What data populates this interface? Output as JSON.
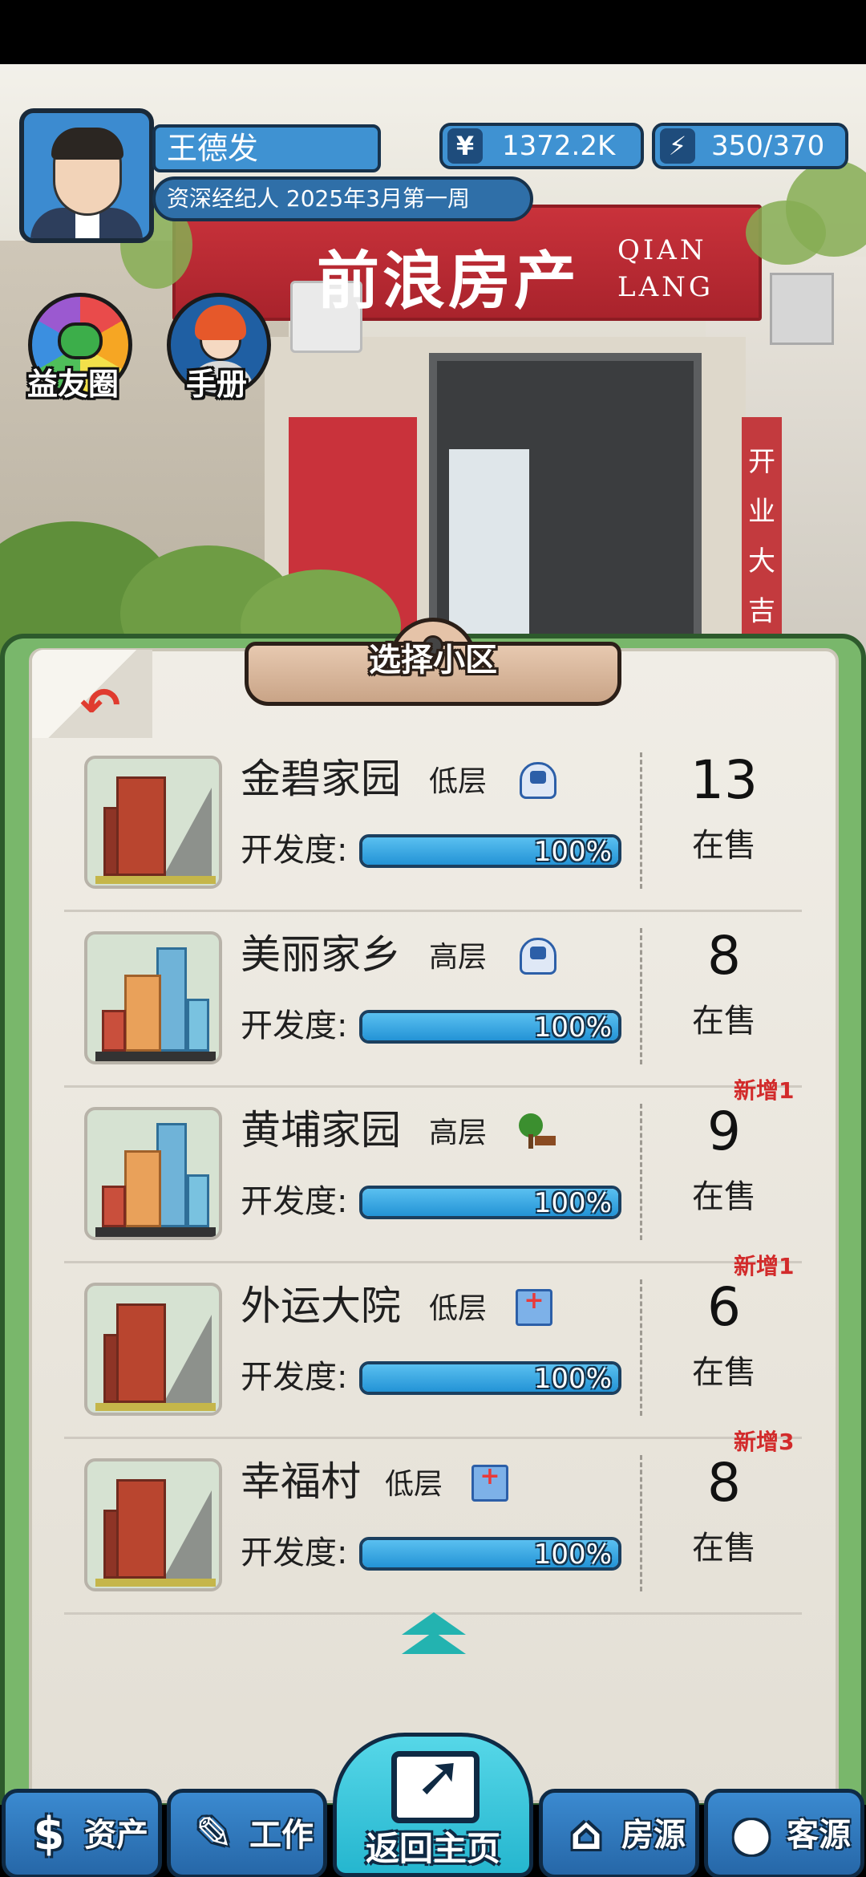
{
  "player": {
    "name": "王德发",
    "title": "资深经纪人 2025年3月第一周",
    "money": "1372.2K",
    "money_icon": "¥",
    "energy": "350/370",
    "energy_icon": "⚡"
  },
  "quick_buttons": [
    {
      "label": "益友圈",
      "icon": "chat-wheel-icon"
    },
    {
      "label": "手册",
      "icon": "girl-portrait-icon"
    }
  ],
  "scene": {
    "sign_cn": "前浪房产",
    "sign_en_line1": "QIAN",
    "sign_en_line2": "LANG",
    "strip_text": "开业大吉"
  },
  "panel": {
    "title": "选择小区",
    "back_icon": "back-arrow-icon",
    "dev_label": "开发度:",
    "onsale_label": "在售",
    "items": [
      {
        "name": "金碧家园",
        "type": "低层",
        "amenity": "metro",
        "dev": "100%",
        "dev_value": 100,
        "count": "13",
        "badge": ""
      },
      {
        "name": "美丽家乡",
        "type": "高层",
        "amenity": "metro",
        "dev": "100%",
        "dev_value": 100,
        "count": "8",
        "badge": ""
      },
      {
        "name": "黄埔家园",
        "type": "高层",
        "amenity": "park",
        "dev": "100%",
        "dev_value": 100,
        "count": "9",
        "badge": "新增1"
      },
      {
        "name": "外运大院",
        "type": "低层",
        "amenity": "hospital",
        "dev": "100%",
        "dev_value": 100,
        "count": "6",
        "badge": "新增1"
      },
      {
        "name": "幸福村",
        "type": "低层",
        "amenity": "hospital",
        "dev": "100%",
        "dev_value": 100,
        "count": "8",
        "badge": "新增3"
      }
    ]
  },
  "nav": {
    "assets": "资产",
    "assets_icon": "$",
    "work": "工作",
    "work_icon": "✎",
    "home": "返回主页",
    "listings": "房源",
    "listings_icon": "⌂",
    "clients": "客源",
    "clients_icon": "●"
  }
}
